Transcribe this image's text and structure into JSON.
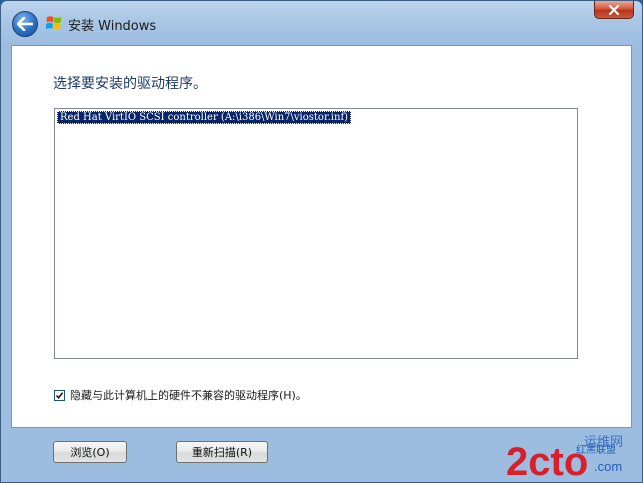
{
  "window": {
    "title": "安装 Windows"
  },
  "page": {
    "heading": "选择要安装的驱动程序。"
  },
  "driver_list": {
    "items": [
      "Red Hat VirtIO SCSI controller (A:\\i386\\Win7\\viostor.inf)"
    ]
  },
  "hide_incompatible": {
    "label": "隐藏与此计算机上的硬件不兼容的驱动程序(H)。",
    "checked": true
  },
  "buttons": {
    "browse": "浏览(O)",
    "rescan": "重新扫描(R)"
  },
  "watermark": {
    "text_main": "2cto",
    "text_top": "红黑联盟",
    "text_small": "运维网",
    "text_domain": ".com"
  },
  "colors": {
    "selection": "#0a246a",
    "heading": "#1c3a6e",
    "frame": "#9dbde0",
    "watermark_red": "#d9202a",
    "watermark_blue": "#1f5fb8"
  }
}
